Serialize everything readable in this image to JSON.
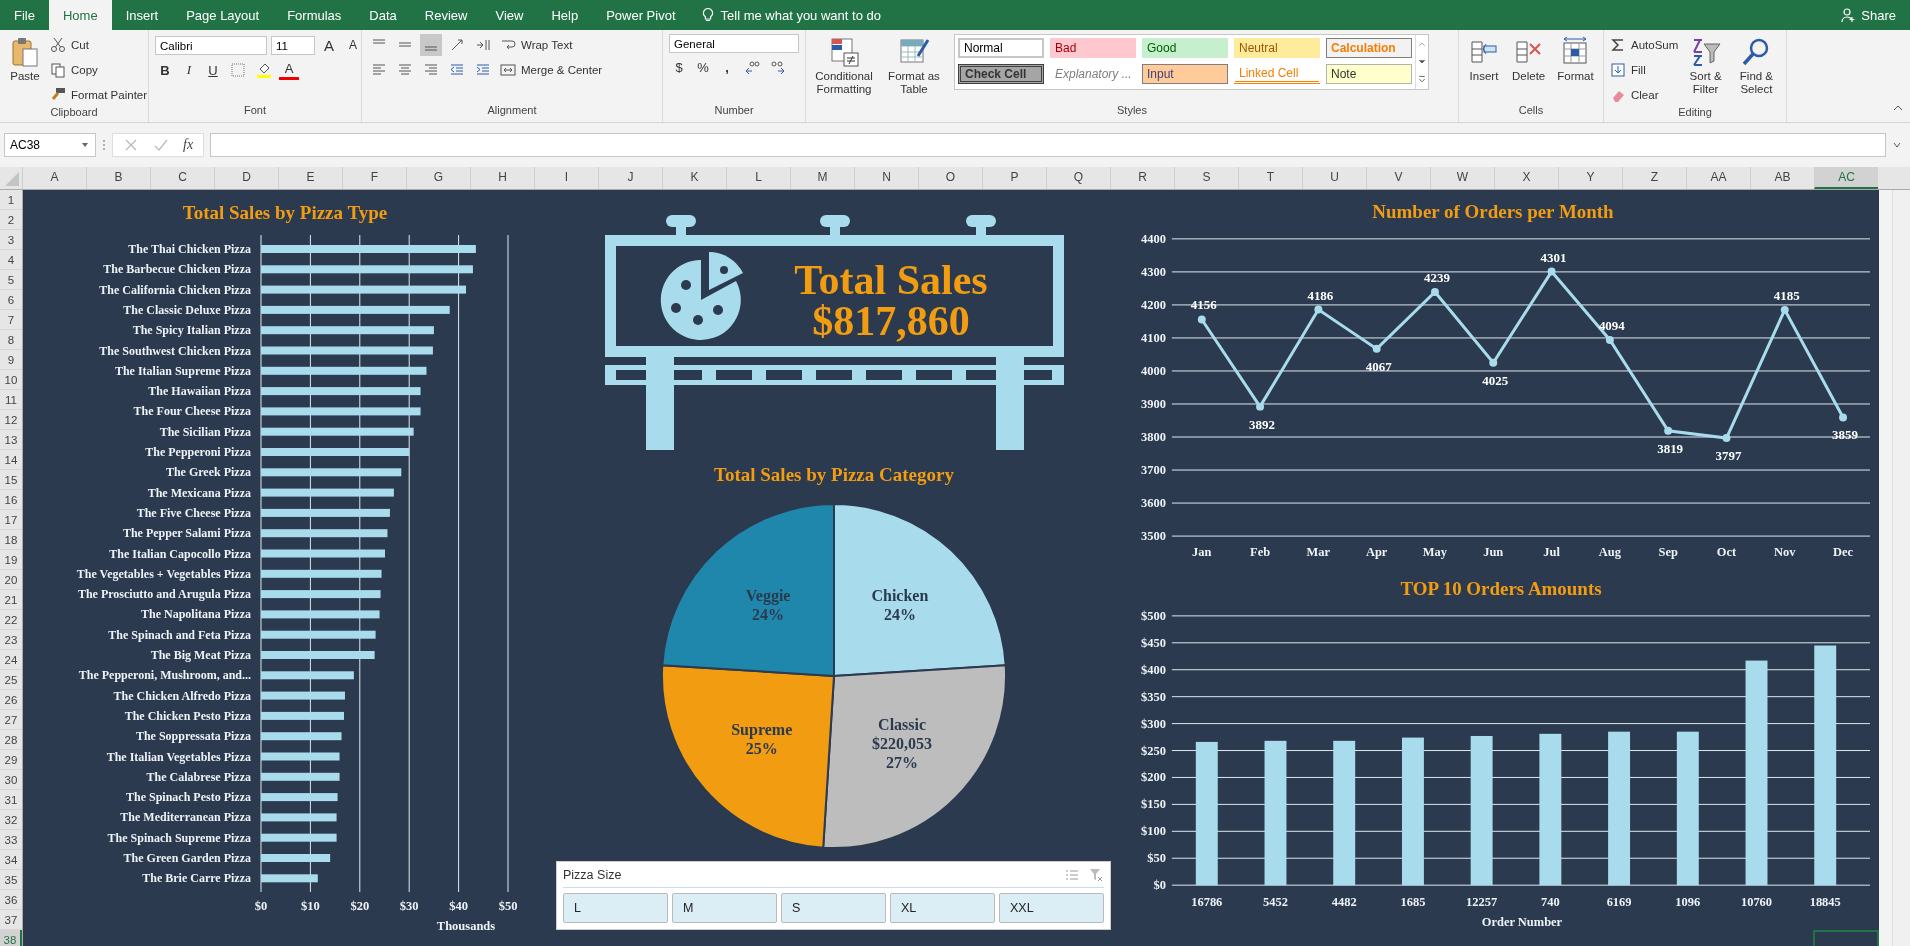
{
  "tabs": [
    {
      "label": "File",
      "selected": false
    },
    {
      "label": "Home",
      "selected": true
    },
    {
      "label": "Insert",
      "selected": false
    },
    {
      "label": "Page Layout",
      "selected": false
    },
    {
      "label": "Formulas",
      "selected": false
    },
    {
      "label": "Data",
      "selected": false
    },
    {
      "label": "Review",
      "selected": false
    },
    {
      "label": "View",
      "selected": false
    },
    {
      "label": "Help",
      "selected": false
    },
    {
      "label": "Power Pivot",
      "selected": false
    }
  ],
  "tell_me": {
    "label": "Tell me what you want to do"
  },
  "share": "Share",
  "clipboard": {
    "label": "Clipboard",
    "paste": "Paste",
    "cut": "Cut",
    "copy": "Copy",
    "format_painter": "Format Painter"
  },
  "font": {
    "label": "Font",
    "family": "Calibri",
    "size": "11",
    "grow": "A",
    "shrink": "A",
    "bold": "B",
    "italic": "I",
    "underline": "U",
    "font_color": "A"
  },
  "alignment": {
    "label": "Alignment",
    "wrap_text": "Wrap Text",
    "merge_center": "Merge & Center"
  },
  "number": {
    "label": "Number",
    "format": "General",
    "currency": "$",
    "percent": "%",
    "comma": ","
  },
  "styles": {
    "label": "Styles",
    "conditional_formatting": "Conditional Formatting",
    "format_as_table": "Format as Table",
    "cell_styles": [
      {
        "label": "Normal",
        "kind": "normal"
      },
      {
        "label": "Bad",
        "kind": "bad"
      },
      {
        "label": "Good",
        "kind": "good"
      },
      {
        "label": "Neutral",
        "kind": "neutral"
      },
      {
        "label": "Calculation",
        "kind": "calculation"
      },
      {
        "label": "Check Cell",
        "kind": "check"
      },
      {
        "label": "Explanatory ...",
        "kind": "explanatory"
      },
      {
        "label": "Input",
        "kind": "input"
      },
      {
        "label": "Linked Cell",
        "kind": "linked"
      },
      {
        "label": "Note",
        "kind": "note"
      }
    ]
  },
  "cells": {
    "label": "Cells",
    "insert": "Insert",
    "delete": "Delete",
    "format": "Format"
  },
  "editing": {
    "label": "Editing",
    "autosum": "AutoSum",
    "fill": "Fill",
    "clear": "Clear",
    "sort_filter": "Sort & Filter",
    "find_select": "Find & Select"
  },
  "formula_bar": {
    "name_box": "AC38",
    "function_label": "fx"
  },
  "columns": [
    {
      "label": "A",
      "selected": false
    },
    {
      "label": "B",
      "selected": false
    },
    {
      "label": "C",
      "selected": false
    },
    {
      "label": "D",
      "selected": false
    },
    {
      "label": "E",
      "selected": false
    },
    {
      "label": "F",
      "selected": false
    },
    {
      "label": "G",
      "selected": false
    },
    {
      "label": "H",
      "selected": false
    },
    {
      "label": "I",
      "selected": false
    },
    {
      "label": "J",
      "selected": false
    },
    {
      "label": "K",
      "selected": false
    },
    {
      "label": "L",
      "selected": false
    },
    {
      "label": "M",
      "selected": false
    },
    {
      "label": "N",
      "selected": false
    },
    {
      "label": "O",
      "selected": false
    },
    {
      "label": "P",
      "selected": false
    },
    {
      "label": "Q",
      "selected": false
    },
    {
      "label": "R",
      "selected": false
    },
    {
      "label": "S",
      "selected": false
    },
    {
      "label": "T",
      "selected": false
    },
    {
      "label": "U",
      "selected": false
    },
    {
      "label": "V",
      "selected": false
    },
    {
      "label": "W",
      "selected": false
    },
    {
      "label": "X",
      "selected": false
    },
    {
      "label": "Y",
      "selected": false
    },
    {
      "label": "Z",
      "selected": false
    },
    {
      "label": "AA",
      "selected": false
    },
    {
      "label": "AB",
      "selected": false
    },
    {
      "label": "AC",
      "selected": true
    }
  ],
  "rows": [
    {
      "label": "1",
      "selected": false
    },
    {
      "label": "2",
      "selected": false
    },
    {
      "label": "3",
      "selected": false
    },
    {
      "label": "4",
      "selected": false
    },
    {
      "label": "5",
      "selected": false
    },
    {
      "label": "6",
      "selected": false
    },
    {
      "label": "7",
      "selected": false
    },
    {
      "label": "8",
      "selected": false
    },
    {
      "label": "9",
      "selected": false
    },
    {
      "label": "10",
      "selected": false
    },
    {
      "label": "11",
      "selected": false
    },
    {
      "label": "12",
      "selected": false
    },
    {
      "label": "13",
      "selected": false
    },
    {
      "label": "14",
      "selected": false
    },
    {
      "label": "15",
      "selected": false
    },
    {
      "label": "16",
      "selected": false
    },
    {
      "label": "17",
      "selected": false
    },
    {
      "label": "18",
      "selected": false
    },
    {
      "label": "19",
      "selected": false
    },
    {
      "label": "20",
      "selected": false
    },
    {
      "label": "21",
      "selected": false
    },
    {
      "label": "22",
      "selected": false
    },
    {
      "label": "23",
      "selected": false
    },
    {
      "label": "24",
      "selected": false
    },
    {
      "label": "25",
      "selected": false
    },
    {
      "label": "26",
      "selected": false
    },
    {
      "label": "27",
      "selected": false
    },
    {
      "label": "28",
      "selected": false
    },
    {
      "label": "29",
      "selected": false
    },
    {
      "label": "30",
      "selected": false
    },
    {
      "label": "31",
      "selected": false
    },
    {
      "label": "32",
      "selected": false
    },
    {
      "label": "33",
      "selected": false
    },
    {
      "label": "34",
      "selected": false
    },
    {
      "label": "35",
      "selected": false
    },
    {
      "label": "36",
      "selected": false
    },
    {
      "label": "37",
      "selected": false
    },
    {
      "label": "38",
      "selected": true
    }
  ],
  "dashboard": {
    "sales_by_type": {
      "chart_data": {
        "type": "bar",
        "orientation": "horizontal",
        "title": "Total Sales by Pizza Type",
        "xlabel": "Thousands",
        "categories": [
          "The Thai Chicken Pizza",
          "The Barbecue Chicken Pizza",
          "The California Chicken Pizza",
          "The Classic Deluxe Pizza",
          "The Spicy Italian Pizza",
          "The Southwest Chicken Pizza",
          "The Italian Supreme Pizza",
          "The Hawaiian Pizza",
          "The Four Cheese Pizza",
          "The Sicilian Pizza",
          "The Pepperoni Pizza",
          "The Greek Pizza",
          "The Mexicana Pizza",
          "The Five Cheese Pizza",
          "The Pepper Salami Pizza",
          "The Italian Capocollo Pizza",
          "The Vegetables + Vegetables Pizza",
          "The Prosciutto and Arugula Pizza",
          "The Napolitana Pizza",
          "The Spinach and Feta Pizza",
          "The Big Meat Pizza",
          "The Pepperoni, Mushroom, and...",
          "The Chicken Alfredo Pizza",
          "The Chicken Pesto Pizza",
          "The Soppressata Pizza",
          "The Italian Vegetables Pizza",
          "The Calabrese Pizza",
          "The Spinach Pesto Pizza",
          "The Mediterranean Pizza",
          "The Spinach Supreme Pizza",
          "The Green Garden Pizza",
          "The Brie Carre Pizza"
        ],
        "values": [
          43.5,
          42.9,
          41.5,
          38.2,
          35.0,
          34.8,
          33.5,
          32.3,
          32.3,
          30.9,
          30.0,
          28.4,
          26.9,
          26.1,
          25.6,
          25.1,
          24.4,
          24.2,
          24.0,
          23.2,
          23.0,
          18.8,
          17.0,
          16.8,
          16.3,
          15.9,
          15.9,
          15.5,
          15.3,
          15.3,
          14.0,
          11.5
        ],
        "grid": true,
        "xlim": [
          0,
          50
        ],
        "xticks": [
          {
            "value": 0,
            "label": "$0"
          },
          {
            "value": 10,
            "label": "$10"
          },
          {
            "value": 20,
            "label": "$20"
          },
          {
            "value": 30,
            "label": "$30"
          },
          {
            "value": 40,
            "label": "$40"
          },
          {
            "value": 50,
            "label": "$50"
          }
        ]
      }
    },
    "billboard": {
      "title": "Total Sales",
      "value": "$817,860"
    },
    "sales_by_category": {
      "chart_data": {
        "type": "pie",
        "title": "Total Sales by Pizza Category",
        "categories": [
          "Chicken",
          "Classic",
          "Supreme",
          "Veggie"
        ],
        "series": [
          {
            "values": [
              24,
              27,
              25,
              24
            ],
            "colors": [
              "#a8dcec",
              "#bdbdbd",
              "#f29c12",
              "#1f87ab"
            ]
          }
        ],
        "value_labels": [
          [
            "24%"
          ],
          [
            "$220,053",
            "27%"
          ],
          [
            "25%"
          ],
          [
            "24%"
          ]
        ]
      }
    },
    "orders_per_month": {
      "chart_data": {
        "type": "line",
        "title": "Number of Orders per Month",
        "categories": [
          "Jan",
          "Feb",
          "Mar",
          "Apr",
          "May",
          "Jun",
          "Jul",
          "Aug",
          "Sep",
          "Oct",
          "Nov",
          "Dec"
        ],
        "series": [
          {
            "color": "#a8dcec",
            "marker": true,
            "values": [
              4156,
              3892,
              4186,
              4067,
              4239,
              4025,
              4301,
              4094,
              3819,
              3797,
              4185,
              3859
            ]
          }
        ],
        "grid": true,
        "ylim": [
          3500,
          4400
        ],
        "yticks": [
          3500,
          3600,
          3700,
          3800,
          3900,
          4000,
          4100,
          4200,
          4300,
          4400
        ],
        "data_labels": true
      }
    },
    "top_orders": {
      "chart_data": {
        "type": "bar",
        "title": "TOP 10 Orders Amounts",
        "xlabel": "Order Number",
        "categories": [
          "16786",
          "5452",
          "4482",
          "1685",
          "12257",
          "740",
          "6169",
          "1096",
          "10760",
          "18845"
        ],
        "values": [
          266,
          268,
          268,
          274,
          277,
          281,
          285,
          285,
          417,
          445
        ],
        "grid": true,
        "ylim": [
          0,
          500
        ],
        "yticks": [
          {
            "value": 0,
            "label": "$0"
          },
          {
            "value": 50,
            "label": "$50"
          },
          {
            "value": 100,
            "label": "$100"
          },
          {
            "value": 150,
            "label": "$150"
          },
          {
            "value": 200,
            "label": "$200"
          },
          {
            "value": 250,
            "label": "$250"
          },
          {
            "value": 300,
            "label": "$300"
          },
          {
            "value": 350,
            "label": "$350"
          },
          {
            "value": 400,
            "label": "$400"
          },
          {
            "value": 450,
            "label": "$450"
          },
          {
            "value": 500,
            "label": "$500"
          }
        ]
      }
    },
    "slicer": {
      "title": "Pizza Size",
      "items": [
        {
          "label": "L",
          "selected": true
        },
        {
          "label": "M",
          "selected": true
        },
        {
          "label": "S",
          "selected": true
        },
        {
          "label": "XL",
          "selected": true
        },
        {
          "label": "XXL",
          "selected": true
        }
      ]
    }
  }
}
